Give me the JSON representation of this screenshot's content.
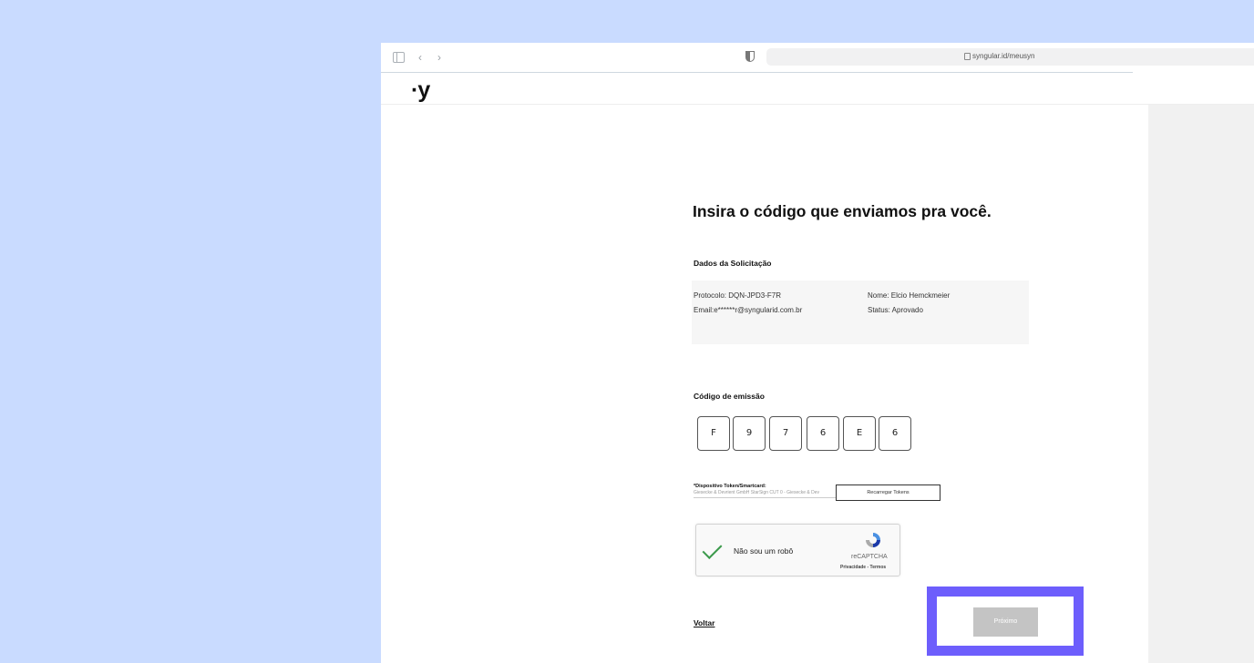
{
  "browser": {
    "url": "syngular.id/meusyn"
  },
  "brand": {
    "logo_text": "·y"
  },
  "page": {
    "title": "Insira o código que enviamos pra você.",
    "request_section_label": "Dados da Solicitação",
    "request": {
      "protocol": "Protocolo: DQN-JPD3-F7R",
      "email": "Email:e******r@syngularid.com.br",
      "name": "Nome: Elcio Hemckmeier",
      "status": "Status: Aprovado"
    },
    "code_label": "Código de emissão",
    "code_digits": [
      "F",
      "9",
      "7",
      "6",
      "E",
      "6"
    ],
    "token_label": "*Dispositivo Token/Smartcard:",
    "token_value": "Giesecke & Devrient GmbH StarSign CUT 0 - Giesecke & Dev",
    "reload_tokens_label": "Recarregar Tokens",
    "captcha": {
      "label": "Não sou um robô",
      "brand": "reCAPTCHA",
      "links": "Privacidade - Termos",
      "checked": true
    },
    "back_label": "Voltar",
    "next_label": "Próximo"
  },
  "colors": {
    "background_blue": "#c9dbff",
    "highlight": "#6d5efc",
    "next_button_disabled": "#c4c4c4",
    "check_green": "#3c9a4c"
  }
}
